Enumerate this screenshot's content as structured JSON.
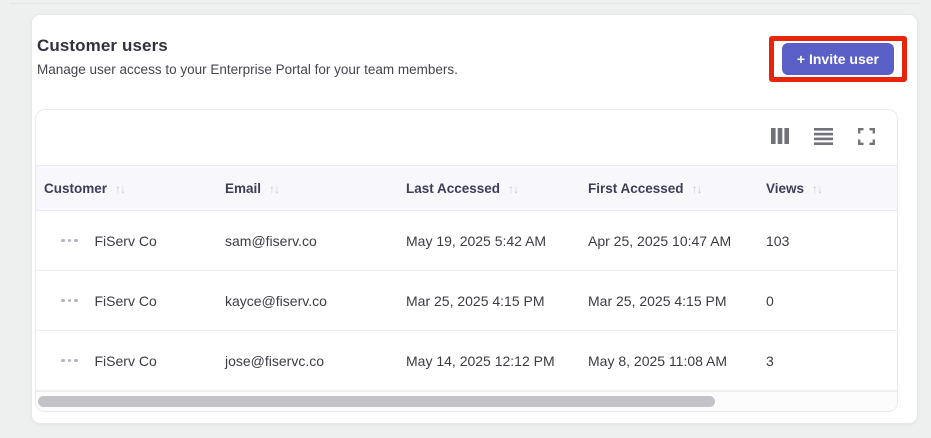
{
  "page": {
    "background": "#eef0f0",
    "accent_color": "#5a5fc8",
    "highlight_color": "#e8240b"
  },
  "header": {
    "title": "Customer users",
    "subtitle": "Manage user access to your Enterprise Portal for your team members.",
    "invite_button_label": "+ Invite user"
  },
  "toolbar": {
    "icons": [
      {
        "name": "columns-icon"
      },
      {
        "name": "row-density-icon"
      },
      {
        "name": "fullscreen-icon"
      }
    ]
  },
  "table": {
    "sort_glyph": "↑↓",
    "columns": [
      {
        "label": "Customer",
        "sortable": true
      },
      {
        "label": "Email",
        "sortable": true
      },
      {
        "label": "Last Accessed",
        "sortable": true
      },
      {
        "label": "First Accessed",
        "sortable": true
      },
      {
        "label": "Views",
        "sortable": true
      }
    ],
    "rows": [
      {
        "customer": "FiServ Co",
        "email": "sam@fiserv.co",
        "last_accessed": "May 19, 2025 5:42 AM",
        "first_accessed": "Apr 25, 2025 10:47 AM",
        "views": "103"
      },
      {
        "customer": "FiServ Co",
        "email": "kayce@fiserv.co",
        "last_accessed": "Mar 25, 2025 4:15 PM",
        "first_accessed": "Mar 25, 2025 4:15 PM",
        "views": "0"
      },
      {
        "customer": "FiServ Co",
        "email": "jose@fiservc.co",
        "last_accessed": "May 14, 2025 12:12 PM",
        "first_accessed": "May 8, 2025 11:08 AM",
        "views": "3"
      }
    ],
    "scrollbar": {
      "thumb_percent": 79
    }
  }
}
